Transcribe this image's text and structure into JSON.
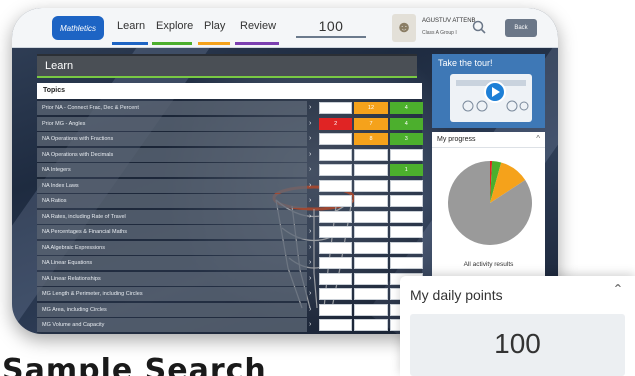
{
  "header": {
    "logo_text": "Mathletics",
    "nav": [
      {
        "label": "Learn",
        "color": "#1d64c4"
      },
      {
        "label": "Explore",
        "color": "#4caf2d"
      },
      {
        "label": "Play",
        "color": "#f5a21b"
      },
      {
        "label": "Review",
        "color": "#7b3fb0"
      }
    ],
    "points": "100",
    "user_name": "AGUSTUV ATTENB...",
    "user_class": "Class A Group I",
    "back_label": "Back"
  },
  "section_title": "Learn",
  "topics": {
    "heading": "Topics",
    "rows": [
      {
        "label": "Prior NA - Connect Frac, Dec & Percent",
        "cells": [
          {
            "t": "",
            "c": "white"
          },
          {
            "t": "12",
            "c": "orange"
          },
          {
            "t": "4",
            "c": "green"
          }
        ]
      },
      {
        "label": "Prior MG - Angles",
        "cells": [
          {
            "t": "2",
            "c": "red"
          },
          {
            "t": "7",
            "c": "orange"
          },
          {
            "t": "4",
            "c": "green"
          }
        ]
      },
      {
        "label": "NA Operations with Fractions",
        "cells": [
          {
            "t": "",
            "c": "white"
          },
          {
            "t": "8",
            "c": "orange"
          },
          {
            "t": "3",
            "c": "green"
          }
        ]
      },
      {
        "label": "NA Operations with Decimals",
        "cells": [
          {
            "t": "",
            "c": "white"
          },
          {
            "t": "",
            "c": "white"
          },
          {
            "t": "",
            "c": "white"
          }
        ]
      },
      {
        "label": "NA Integers",
        "cells": [
          {
            "t": "",
            "c": "white"
          },
          {
            "t": "",
            "c": "white"
          },
          {
            "t": "1",
            "c": "green"
          }
        ]
      },
      {
        "label": "NA Index Laws",
        "cells": [
          {
            "t": "",
            "c": "white"
          },
          {
            "t": "",
            "c": "white"
          },
          {
            "t": "",
            "c": "white"
          }
        ]
      },
      {
        "label": "NA Ratios",
        "cells": [
          {
            "t": "",
            "c": "white"
          },
          {
            "t": "",
            "c": "white"
          },
          {
            "t": "",
            "c": "white"
          }
        ]
      },
      {
        "label": "NA Rates, including Rate of Travel",
        "cells": [
          {
            "t": "",
            "c": "white"
          },
          {
            "t": "",
            "c": "white"
          },
          {
            "t": "",
            "c": "white"
          }
        ]
      },
      {
        "label": "NA Percentages & Financial Maths",
        "cells": [
          {
            "t": "",
            "c": "white"
          },
          {
            "t": "",
            "c": "white"
          },
          {
            "t": "",
            "c": "white"
          }
        ]
      },
      {
        "label": "NA Algebraic Expressions",
        "cells": [
          {
            "t": "",
            "c": "white"
          },
          {
            "t": "",
            "c": "white"
          },
          {
            "t": "",
            "c": "white"
          }
        ]
      },
      {
        "label": "NA Linear Equations",
        "cells": [
          {
            "t": "",
            "c": "white"
          },
          {
            "t": "",
            "c": "white"
          },
          {
            "t": "",
            "c": "white"
          }
        ]
      },
      {
        "label": "NA Linear Relationships",
        "cells": [
          {
            "t": "",
            "c": "white"
          },
          {
            "t": "",
            "c": "white"
          },
          {
            "t": "",
            "c": "white"
          }
        ]
      },
      {
        "label": "MG Length & Perimeter, including Circles",
        "cells": [
          {
            "t": "",
            "c": "white"
          },
          {
            "t": "",
            "c": "white"
          },
          {
            "t": "",
            "c": "white"
          }
        ]
      },
      {
        "label": "MG Area, including Circles",
        "cells": [
          {
            "t": "",
            "c": "white"
          },
          {
            "t": "",
            "c": "white"
          },
          {
            "t": "",
            "c": "white"
          }
        ]
      },
      {
        "label": "MG Volume and Capacity",
        "cells": [
          {
            "t": "",
            "c": "white"
          },
          {
            "t": "",
            "c": "white"
          },
          {
            "t": "",
            "c": "white"
          }
        ]
      }
    ]
  },
  "tour": {
    "title": "Take the tour!"
  },
  "progress": {
    "title": "My progress",
    "caption": "All activity results",
    "slices": [
      {
        "value": 0.8,
        "color": "#e02424"
      },
      {
        "value": 3.5,
        "color": "#4caf2d"
      },
      {
        "value": 11.5,
        "color": "#f5a21b"
      },
      {
        "value": 84.2,
        "color": "#9a9a9a"
      }
    ]
  },
  "daily_points": {
    "title": "My daily points",
    "value": "100"
  },
  "heading_fragment": "Sample Search"
}
